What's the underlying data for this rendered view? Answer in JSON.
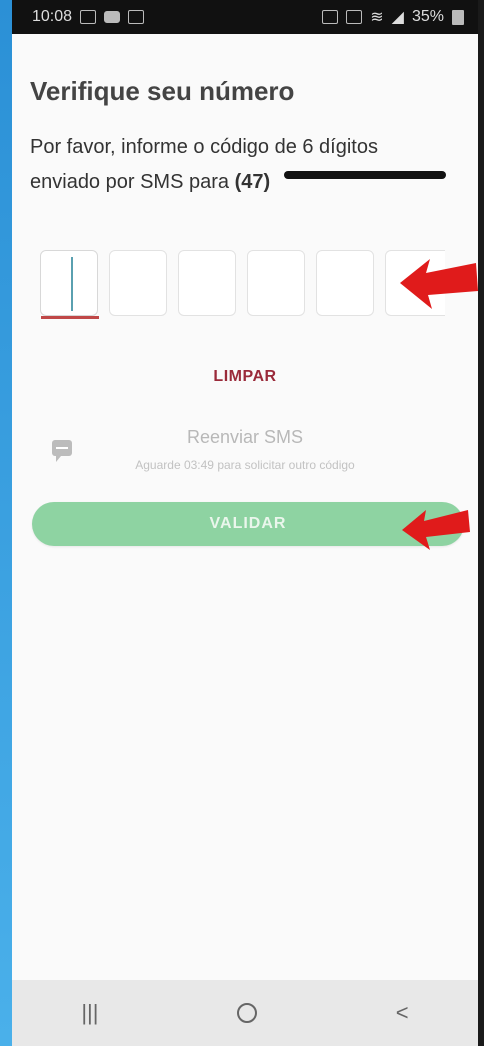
{
  "status_bar": {
    "time": "10:08",
    "battery": "35%"
  },
  "screen": {
    "title": "Verifique seu número",
    "subtitle_line1": "Por favor, informe o código de 6 dígitos",
    "subtitle_line2_prefix": "enviado por SMS para",
    "area_code": "(47)",
    "clear_label": "LIMPAR",
    "resend_label": "Reenviar SMS",
    "wait_text": "Aguarde 03:49 para solicitar outro código",
    "validate_label": "VALIDAR"
  },
  "code_inputs": [
    "",
    "",
    "",
    "",
    "",
    ""
  ],
  "nav": {
    "recents": "|||",
    "back": "<"
  },
  "colors": {
    "accent_red": "#9a2a3a",
    "button_green": "#8ed3a2",
    "arrow_red": "#e01b1b"
  }
}
